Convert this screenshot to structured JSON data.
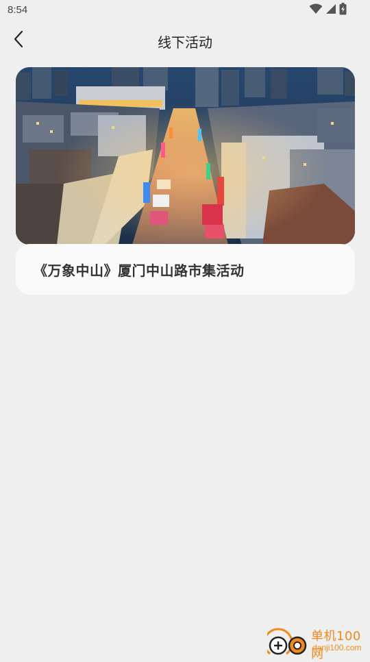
{
  "status_bar": {
    "time": "8:54"
  },
  "header": {
    "title": "线下活动",
    "back_icon": "chevron-left-icon"
  },
  "activities": [
    {
      "title": "《万象中山》厦门中山路市集活动",
      "image": "night-street-market-aerial-photo"
    }
  ],
  "watermark": {
    "name": "单机100网",
    "url": "danji100.com"
  },
  "colors": {
    "background": "#efefef",
    "card": "#fafafa",
    "watermark": "#f08a1c"
  }
}
